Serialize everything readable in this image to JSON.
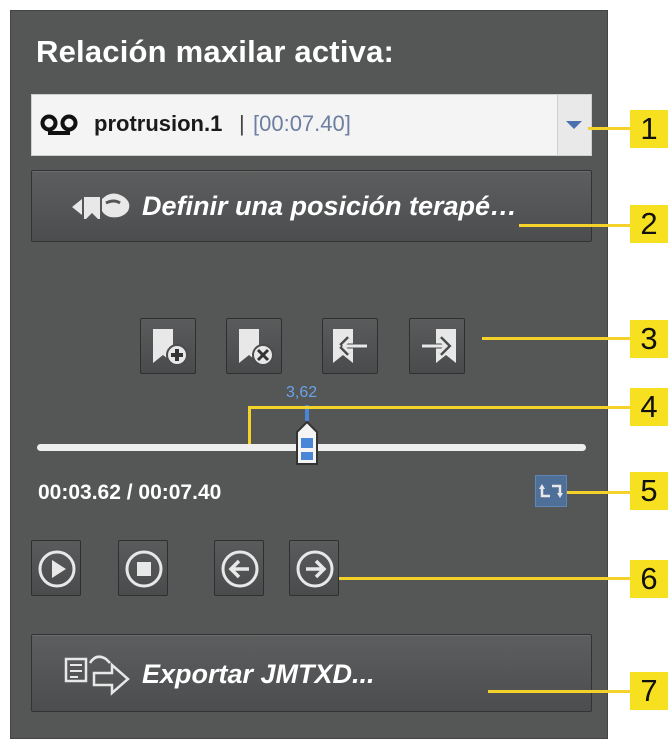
{
  "panel": {
    "title": "Relación maxilar activa:"
  },
  "dropdown": {
    "icon": "cassette-tape-icon",
    "name": "protrusion.1",
    "separator": "|",
    "time": "[00:07.40]"
  },
  "define_button": {
    "label": "Definir una posición terapé…",
    "icon": "therapeutic-position-icon"
  },
  "bookmark_buttons": [
    {
      "icon": "bookmark-add-icon"
    },
    {
      "icon": "bookmark-remove-icon"
    },
    {
      "icon": "bookmark-previous-icon"
    },
    {
      "icon": "bookmark-next-icon"
    }
  ],
  "slider": {
    "value_label": "3,62",
    "position_fraction": 0.489
  },
  "time_display": "00:03.62 / 00:07.40",
  "loop_button": {
    "icon": "loop-icon"
  },
  "playback": [
    {
      "icon": "play-icon"
    },
    {
      "icon": "stop-icon"
    },
    {
      "icon": "step-back-icon"
    },
    {
      "icon": "step-forward-icon"
    }
  ],
  "export_button": {
    "label": "Exportar JMTXD...",
    "icon": "export-arrow-icon"
  },
  "callouts": [
    "1",
    "2",
    "3",
    "4",
    "5",
    "6",
    "7"
  ],
  "colors": {
    "panel": "#555656",
    "callout": "#f7e01f",
    "slider_accent": "#4a86d8",
    "time_muted": "#6d7ea0"
  }
}
